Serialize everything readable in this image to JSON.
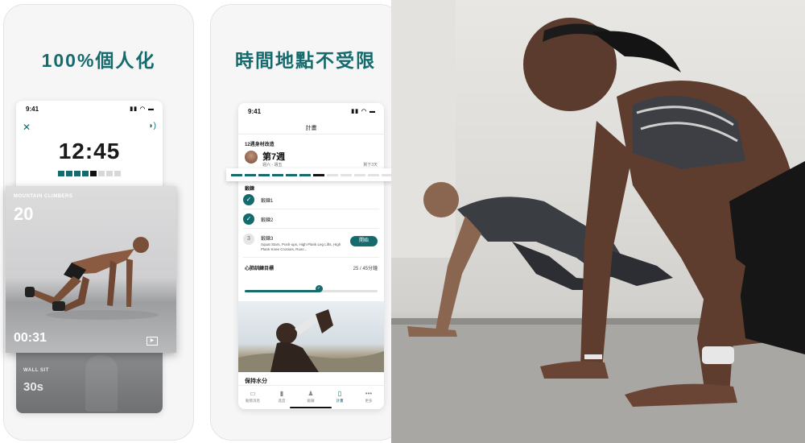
{
  "card1": {
    "headline": "100%個人化",
    "phone": {
      "time": "9:41",
      "timer": "12:45",
      "timer_progress": {
        "done": 4,
        "current": 1,
        "total": 8
      }
    },
    "exercise": {
      "name": "MOUNTAIN CLIMBERS",
      "reps": "20",
      "time": "00:31"
    },
    "next_exercise": {
      "name": "WALL SIT",
      "time": "30s"
    }
  },
  "card2": {
    "headline": "時間地點不受限",
    "phone": {
      "time": "9:41",
      "nav_title": "計畫",
      "program_name": "12週身材改造",
      "week": "第7週",
      "week_days": "週六 - 週五",
      "days_left": "剩下3天",
      "section": "鍛鍊",
      "workouts": [
        {
          "label": "鍛鍊1",
          "status": "done"
        },
        {
          "label": "鍛鍊2",
          "status": "done"
        },
        {
          "label": "鍛鍊3",
          "number": "3",
          "status": "pending",
          "description": "Squat Stars, Push-ups, High Plank Leg Lifts, High Plank Knee Crosses, Russ...",
          "button": "開始"
        }
      ],
      "cardio_label": "心肺訓練目標",
      "cardio_value": "25 / 45分鐘",
      "cardio_progress": 0.555,
      "hydrate_title": "保持水分",
      "tabs": [
        {
          "label": "動態消息",
          "icon": "feed-icon"
        },
        {
          "label": "進度",
          "icon": "chart-icon"
        },
        {
          "label": "鍛鍊",
          "icon": "kettlebell-icon"
        },
        {
          "label": "計畫",
          "icon": "plan-icon",
          "active": true
        },
        {
          "label": "更多",
          "icon": "more-icon"
        }
      ]
    },
    "week_progress": {
      "done": 6,
      "current": 1,
      "total": 12
    }
  },
  "colors": {
    "accent": "#156a6d",
    "current": "#111111",
    "inactive": "#d8d8d8"
  }
}
